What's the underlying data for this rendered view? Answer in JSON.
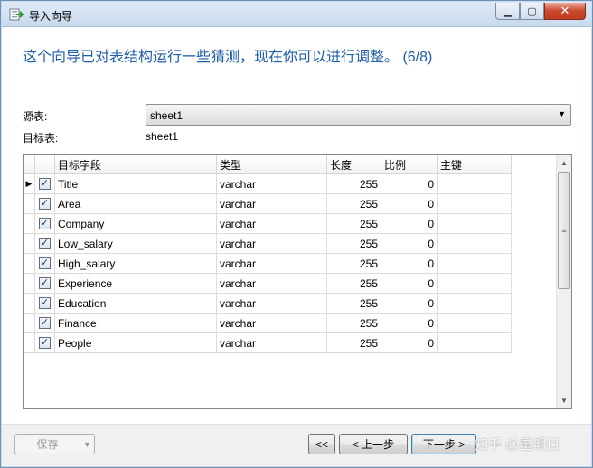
{
  "window": {
    "title": "导入向导",
    "min_glyph": "▁",
    "max_glyph": "▢",
    "close_glyph": "✕"
  },
  "headline": "这个向导已对表结构运行一些猜测，现在你可以进行调整。 (6/8)",
  "source": {
    "label": "源表:",
    "value": "sheet1"
  },
  "target": {
    "label": "目标表:",
    "value": "sheet1"
  },
  "grid": {
    "columns": [
      "目标字段",
      "类型",
      "长度",
      "比例",
      "主键"
    ],
    "rows": [
      {
        "field": "Title",
        "type": "varchar",
        "length": "255",
        "scale": "0",
        "pk": ""
      },
      {
        "field": "Area",
        "type": "varchar",
        "length": "255",
        "scale": "0",
        "pk": ""
      },
      {
        "field": "Company",
        "type": "varchar",
        "length": "255",
        "scale": "0",
        "pk": ""
      },
      {
        "field": "Low_salary",
        "type": "varchar",
        "length": "255",
        "scale": "0",
        "pk": ""
      },
      {
        "field": "High_salary",
        "type": "varchar",
        "length": "255",
        "scale": "0",
        "pk": ""
      },
      {
        "field": "Experience",
        "type": "varchar",
        "length": "255",
        "scale": "0",
        "pk": ""
      },
      {
        "field": "Education",
        "type": "varchar",
        "length": "255",
        "scale": "0",
        "pk": ""
      },
      {
        "field": "Finance",
        "type": "varchar",
        "length": "255",
        "scale": "0",
        "pk": ""
      },
      {
        "field": "People",
        "type": "varchar",
        "length": "255",
        "scale": "0",
        "pk": ""
      }
    ],
    "current_row_glyph": "▶",
    "checked_glyph": "✓"
  },
  "footer": {
    "save_label": "保存",
    "save_dropdown_glyph": "▼",
    "first_label": "<<",
    "prev_label": "< 上一步",
    "next_label": "下一步 >"
  },
  "watermark": "知乎 @星期日",
  "colors": {
    "headline": "#1f5ea8",
    "close_button": "#c9472d",
    "titlebar": "#c9daee"
  }
}
